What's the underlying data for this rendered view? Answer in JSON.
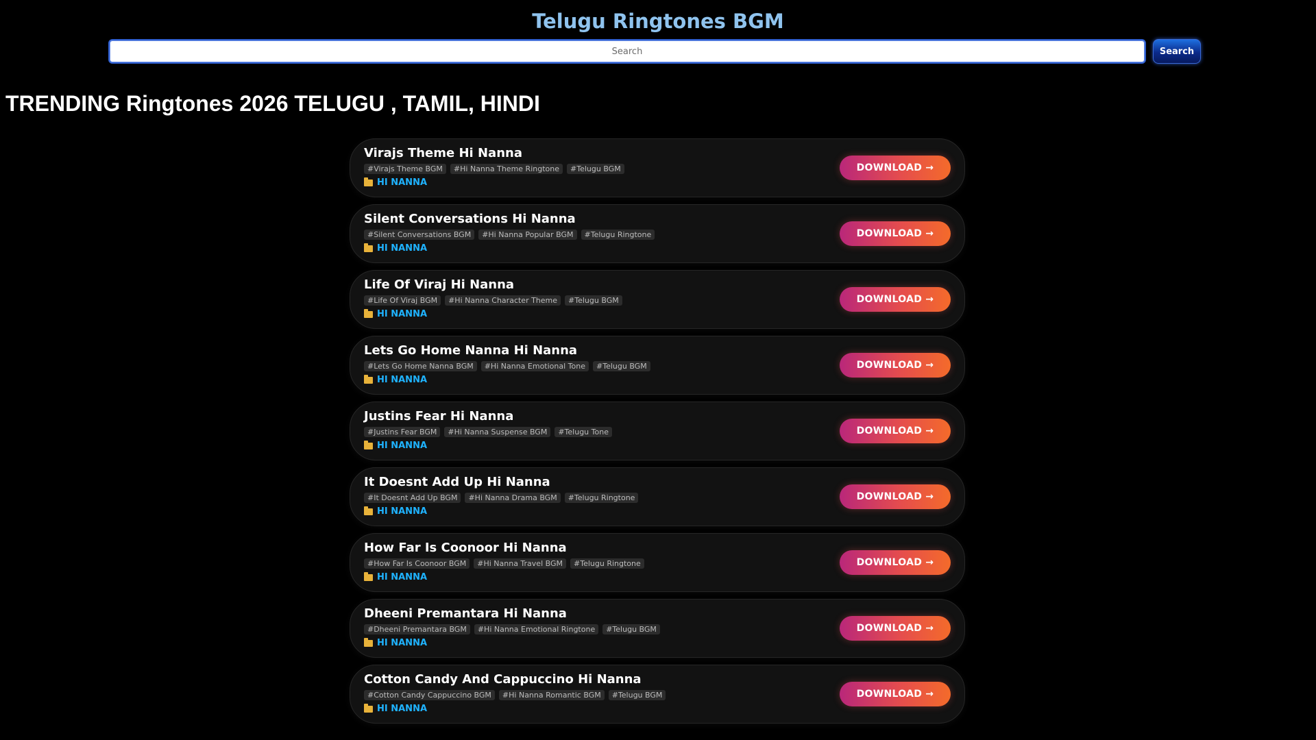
{
  "header": {
    "title": "Telugu Ringtones BGM",
    "search_placeholder": "Search",
    "search_button": "Search"
  },
  "page_heading": "TRENDING Ringtones 2026 TELUGU , TAMIL, HINDI",
  "download_label": "DOWNLOAD →",
  "ringtones": [
    {
      "title": "Virajs Theme Hi Nanna",
      "tags": [
        "#Virajs Theme BGM",
        "#Hi Nanna Theme Ringtone",
        "#Telugu BGM"
      ],
      "category": "HI NANNA"
    },
    {
      "title": "Silent Conversations Hi Nanna",
      "tags": [
        "#Silent Conversations BGM",
        "#Hi Nanna Popular BGM",
        "#Telugu Ringtone"
      ],
      "category": "HI NANNA"
    },
    {
      "title": "Life Of Viraj Hi Nanna",
      "tags": [
        "#Life Of Viraj BGM",
        "#Hi Nanna Character Theme",
        "#Telugu BGM"
      ],
      "category": "HI NANNA"
    },
    {
      "title": "Lets Go Home Nanna Hi Nanna",
      "tags": [
        "#Lets Go Home Nanna BGM",
        "#Hi Nanna Emotional Tone",
        "#Telugu BGM"
      ],
      "category": "HI NANNA"
    },
    {
      "title": "Justins Fear Hi Nanna",
      "tags": [
        "#Justins Fear BGM",
        "#Hi Nanna Suspense BGM",
        "#Telugu Tone"
      ],
      "category": "HI NANNA"
    },
    {
      "title": "It Doesnt Add Up Hi Nanna",
      "tags": [
        "#It Doesnt Add Up BGM",
        "#Hi Nanna Drama BGM",
        "#Telugu Ringtone"
      ],
      "category": "HI NANNA"
    },
    {
      "title": "How Far Is Coonoor Hi Nanna",
      "tags": [
        "#How Far Is Coonoor BGM",
        "#Hi Nanna Travel BGM",
        "#Telugu Ringtone"
      ],
      "category": "HI NANNA"
    },
    {
      "title": "Dheeni Premantara Hi Nanna",
      "tags": [
        "#Dheeni Premantara BGM",
        "#Hi Nanna Emotional Ringtone",
        "#Telugu BGM"
      ],
      "category": "HI NANNA"
    },
    {
      "title": "Cotton Candy And Cappuccino Hi Nanna",
      "tags": [
        "#Cotton Candy Cappuccino BGM",
        "#Hi Nanna Romantic BGM",
        "#Telugu BGM"
      ],
      "category": "HI NANNA"
    }
  ],
  "colors": {
    "background": "#000000",
    "title": "#8fc3ee",
    "category": "#1fb3ff",
    "download_start": "#b9277a",
    "download_end": "#f46b2a"
  }
}
